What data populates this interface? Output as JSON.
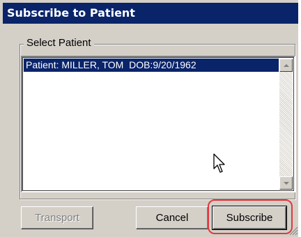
{
  "window": {
    "title": "Subscribe to Patient",
    "title_bar_color": "#0a246a"
  },
  "group": {
    "label": "Select Patient"
  },
  "patient_list": {
    "items": [
      {
        "text": "Patient: MILLER, TOM  DOB:9/20/1962",
        "selected": true
      }
    ],
    "selection_color": "#0a246a"
  },
  "icons": {
    "scroll_up": "scroll-up-arrow-icon",
    "scroll_down": "scroll-down-arrow-icon",
    "cursor": "mouse-pointer-icon",
    "resize_grip": "resize-grip-icon"
  },
  "buttons": {
    "transport": {
      "label": "Transport",
      "enabled": false
    },
    "cancel": {
      "label": "Cancel",
      "enabled": true
    },
    "subscribe": {
      "label": "Subscribe",
      "enabled": true,
      "default": true
    }
  },
  "annotation": {
    "highlight_color": "#e0393e",
    "highlight_target": "subscribe"
  }
}
